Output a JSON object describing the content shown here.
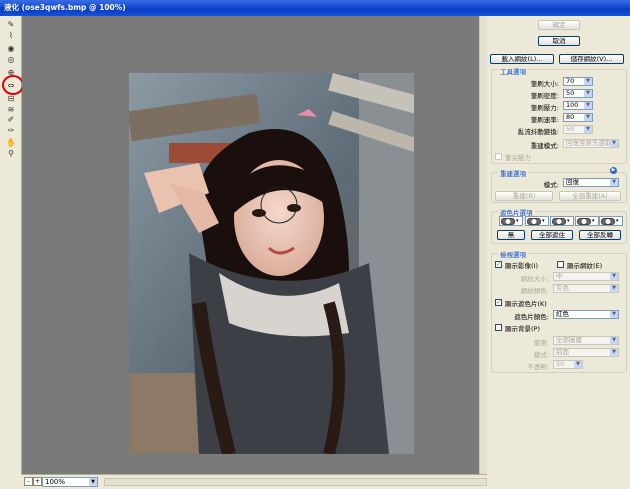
{
  "window": {
    "title": "液化 (ose3qwfs.bmp @ 100%)"
  },
  "toolbar": {
    "tools": [
      "forward-warp",
      "reconstruct",
      "twirl-clockwise",
      "pucker",
      "bloat",
      "push-left",
      "mirror",
      "turbulence",
      "freeze-mask",
      "thaw-mask",
      "hand",
      "zoom"
    ]
  },
  "status": {
    "zoom": "100%"
  },
  "panel": {
    "ok": "確定",
    "cancel": "取消",
    "load_mesh": "載入網紋(L)...",
    "save_mesh": "儲存網紋(V)...",
    "tool_options": {
      "title": "工具選項",
      "brush_size_label": "筆刷大小:",
      "brush_size": "70",
      "brush_density_label": "筆刷密度:",
      "brush_density": "50",
      "brush_pressure_label": "筆刷壓力:",
      "brush_pressure": "100",
      "brush_rate_label": "筆刷速率:",
      "brush_rate": "80",
      "turbulent_jitter_label": "亂流抖動變換:",
      "turbulent_jitter": "50",
      "reconstruct_mode_label": "重建模式:",
      "reconstruct_mode": "回復至原先選取",
      "stylus_pressure": "筆尖壓力"
    },
    "reconstruct_options": {
      "title": "重建選項",
      "mode_label": "模式:",
      "mode": "回復",
      "reconstruct": "重建(R)",
      "restore_all": "全部重建(A)"
    },
    "mask_options": {
      "title": "遮色片選項",
      "none": "無",
      "mask_all": "全部遮住",
      "invert_all": "全部反轉"
    },
    "view_options": {
      "title": "檢視選項",
      "show_image": "顯示影像(I)",
      "show_mesh": "顯示網紋(E)",
      "mesh_size_label": "網紋大小:",
      "mesh_size": "中",
      "mesh_color_label": "網紋顏色:",
      "mesh_color": "灰色",
      "show_mask": "顯示遮色片(K)",
      "mask_color_label": "遮色片顏色:",
      "mask_color": "紅色",
      "show_backdrop": "顯示背景(P)",
      "use_label": "使用:",
      "use": "全部圖層",
      "backdrop_mode_label": "模式:",
      "backdrop_mode": "前面",
      "opacity_label": "不透明:",
      "opacity": "50"
    }
  }
}
